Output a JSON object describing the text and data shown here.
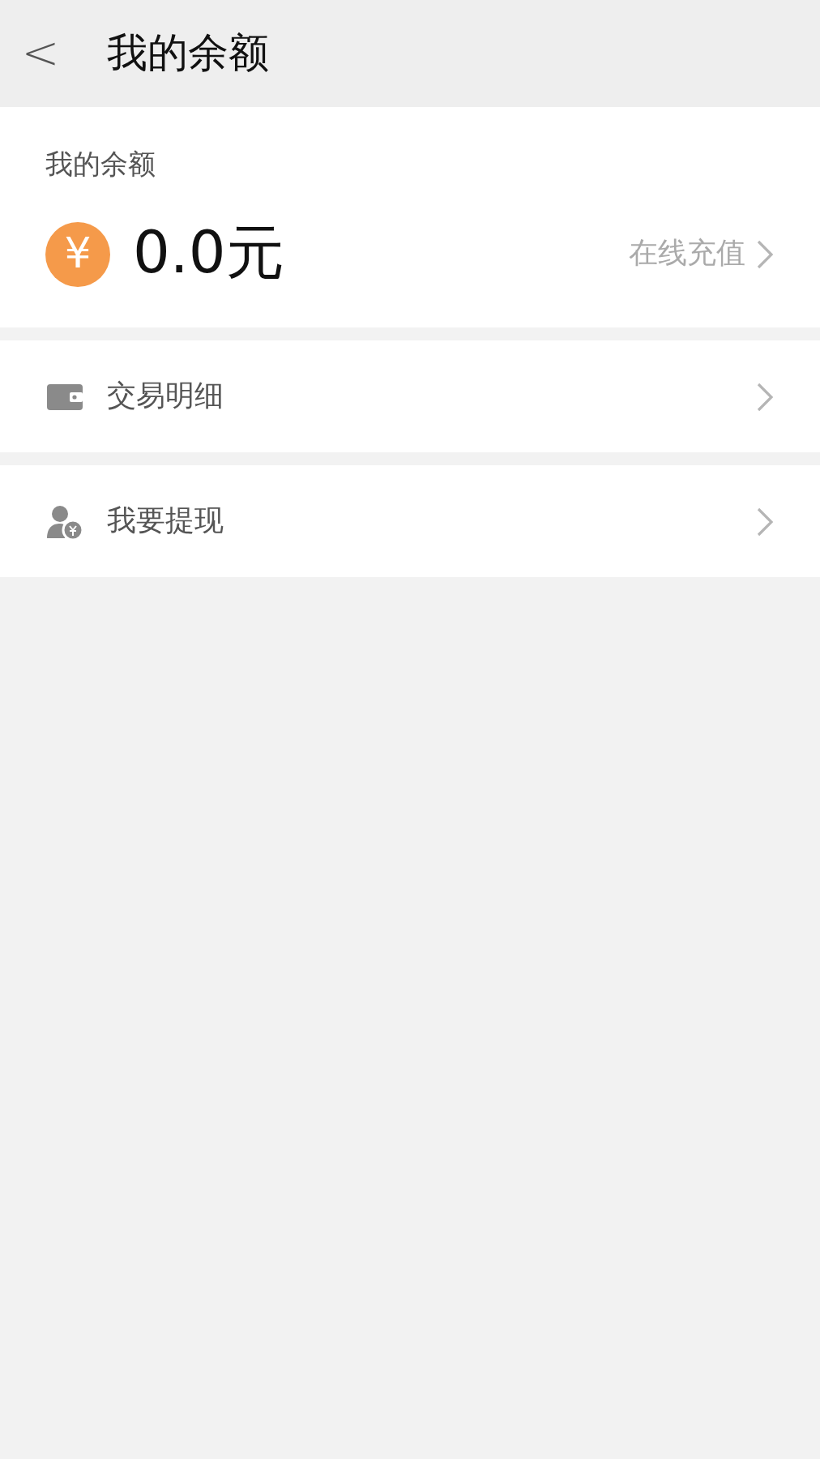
{
  "header": {
    "back_icon": "<",
    "title": "我的余额"
  },
  "balance": {
    "label": "我的余额",
    "currency_symbol": "¥",
    "amount": "0.0元",
    "recharge": "在线充值"
  },
  "menu": [
    {
      "kind": "wallet",
      "label": "交易明细"
    },
    {
      "kind": "withdraw",
      "label": "我要提现"
    }
  ]
}
